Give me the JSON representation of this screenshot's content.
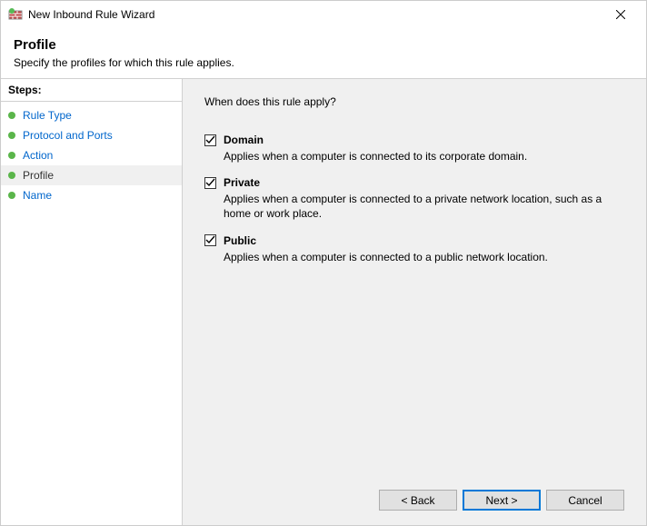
{
  "window": {
    "title": "New Inbound Rule Wizard"
  },
  "header": {
    "title": "Profile",
    "subtitle": "Specify the profiles for which this rule applies."
  },
  "steps": {
    "title": "Steps:",
    "items": [
      {
        "label": "Rule Type"
      },
      {
        "label": "Protocol and Ports"
      },
      {
        "label": "Action"
      },
      {
        "label": "Profile"
      },
      {
        "label": "Name"
      }
    ],
    "current_index": 3
  },
  "content": {
    "question": "When does this rule apply?",
    "profiles": [
      {
        "label": "Domain",
        "description": "Applies when a computer is connected to its corporate domain.",
        "checked": true
      },
      {
        "label": "Private",
        "description": "Applies when a computer is connected to a private network location, such as a home or work place.",
        "checked": true
      },
      {
        "label": "Public",
        "description": "Applies when a computer is connected to a public network location.",
        "checked": true
      }
    ]
  },
  "buttons": {
    "back": "< Back",
    "next": "Next >",
    "cancel": "Cancel"
  }
}
